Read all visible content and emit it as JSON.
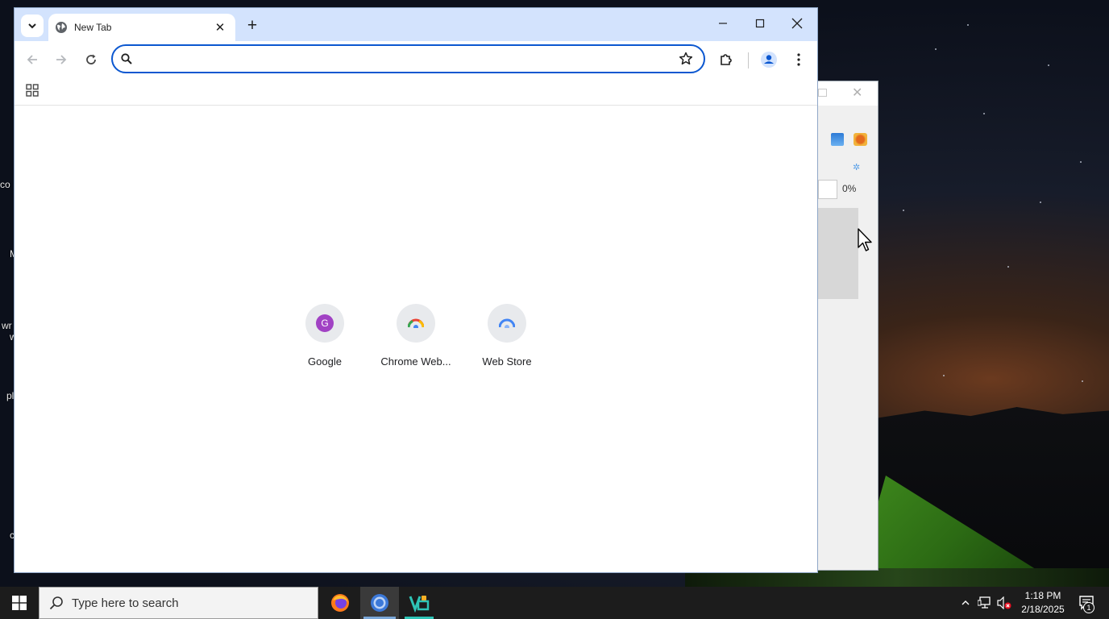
{
  "desktop": {
    "icon_labels": [
      "co",
      "M",
      "wr",
      "w",
      "pl",
      "c"
    ]
  },
  "background_window": {
    "percent_text": "0%",
    "close_glyph": "✕"
  },
  "browser": {
    "tab_search_icon": "chevron-down-icon",
    "tab": {
      "title": "New Tab",
      "favicon": "globe-icon",
      "close_glyph": "✕"
    },
    "new_tab_glyph": "+",
    "window_controls": {
      "minimize": "minimize-icon",
      "maximize": "maximize-icon",
      "close": "close-icon"
    },
    "toolbar": {
      "back": "arrow-left-icon",
      "forward": "arrow-right-icon",
      "reload": "reload-icon",
      "omnibox_value": "",
      "omnibox_placeholder": "",
      "bookmark": "star-icon",
      "extensions": "puzzle-icon",
      "profile": "person-icon",
      "menu": "three-dots-icon"
    },
    "bookmarks_bar": {
      "apps": "apps-grid-icon"
    },
    "new_tab_page": {
      "shortcuts": [
        {
          "label": "Google",
          "icon": "G",
          "badge_color": "#a142c4"
        },
        {
          "label": "Chrome Web...",
          "icon": "chrome-webstore-icon"
        },
        {
          "label": "Web Store",
          "icon": "webstore-icon"
        }
      ]
    }
  },
  "taskbar": {
    "search_placeholder": "Type here to search",
    "apps": [
      "firefox-icon",
      "chrome-icon",
      "code-editor-icon"
    ],
    "active_app": "chrome-icon",
    "clock": {
      "time": "1:18 PM",
      "date": "2/18/2025"
    },
    "notification_count": "1"
  },
  "colors": {
    "title_bar": "#d3e3fd",
    "omnibox_border": "#0b57d0",
    "taskbar": "#1c1c1c",
    "profile_blue": "#0b57d0"
  }
}
